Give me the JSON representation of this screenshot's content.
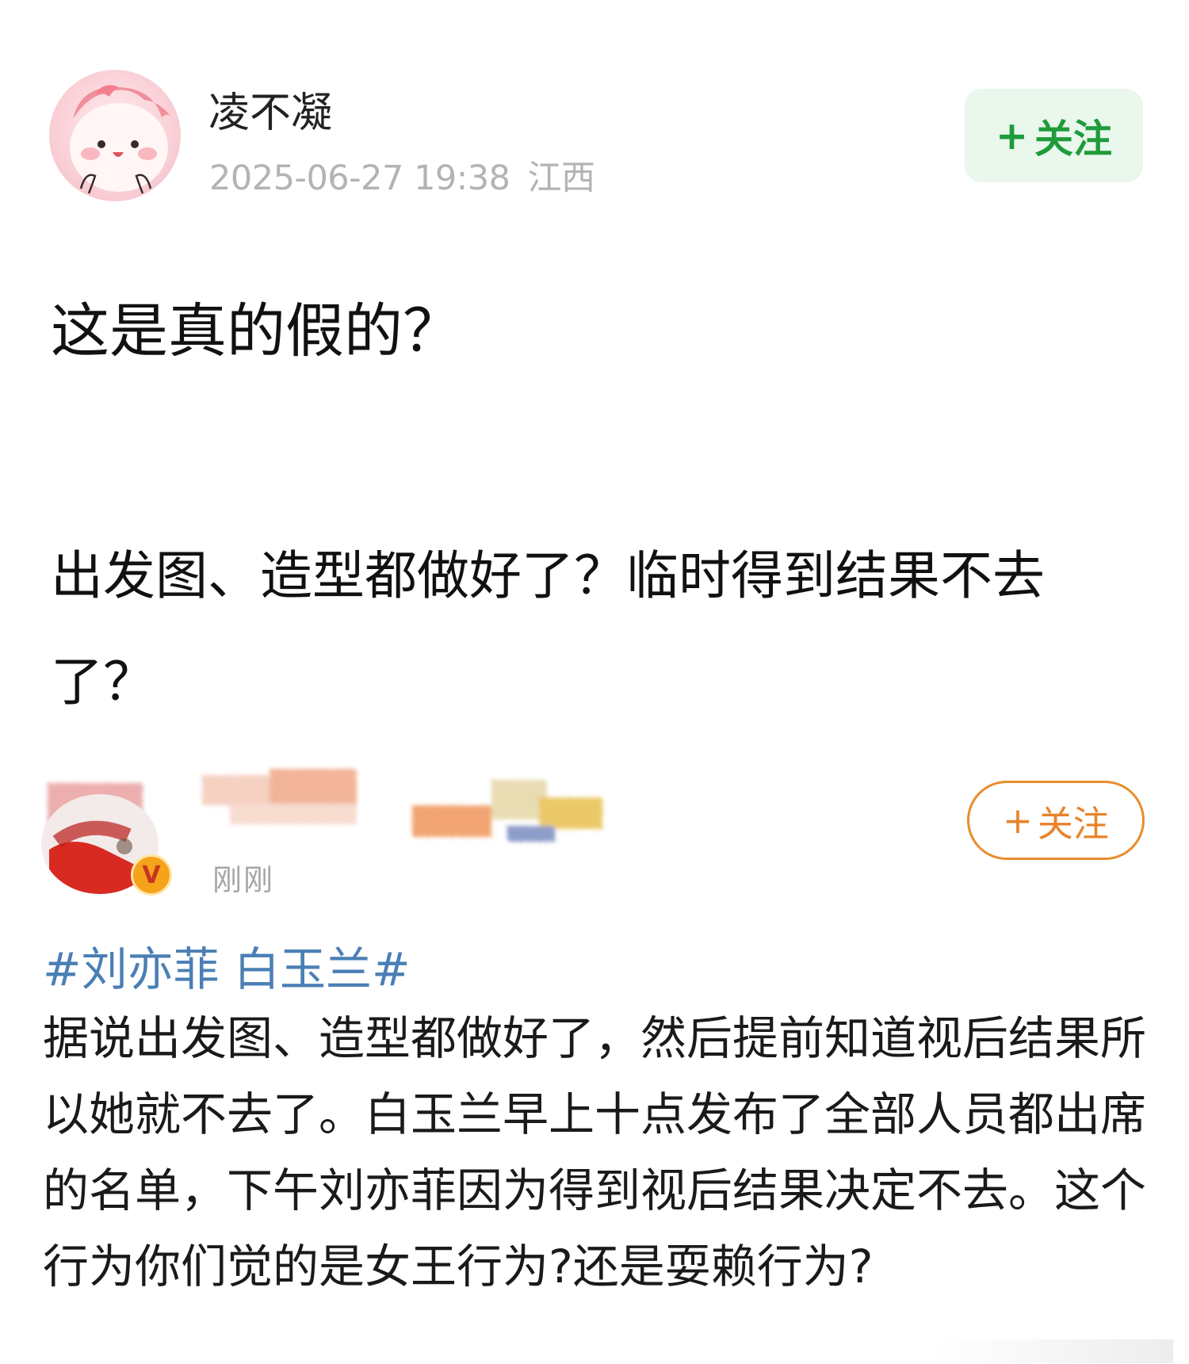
{
  "author": {
    "name": "凌不凝",
    "datetime": "2025-06-27 19:38",
    "location": "江西",
    "avatar_icon": "cartoon-pink-face-avatar"
  },
  "follow_button": {
    "plus": "+",
    "label": "关注",
    "accent": "#1e9b3a",
    "bg": "#e9f7ec"
  },
  "post": {
    "title": "这是真的假的？",
    "body": "出发图、造型都做好了？临时得到结果不去了？"
  },
  "quoted": {
    "time": "刚刚",
    "vip_badge": "V",
    "follow_button": {
      "plus": "+",
      "label": "关注",
      "accent": "#e88d2c"
    },
    "hashtag": "#刘亦菲 白玉兰#",
    "hashtag_color": "#4a7fb5",
    "body": "据说出发图、造型都做好了，然后提前知道视后结果所以她就不去了。白玉兰早上十点发布了全部人员都出席的名单，下午刘亦菲因为得到视后结果决定不去。这个行为你们觉的是女王行为?还是耍赖行为?"
  }
}
